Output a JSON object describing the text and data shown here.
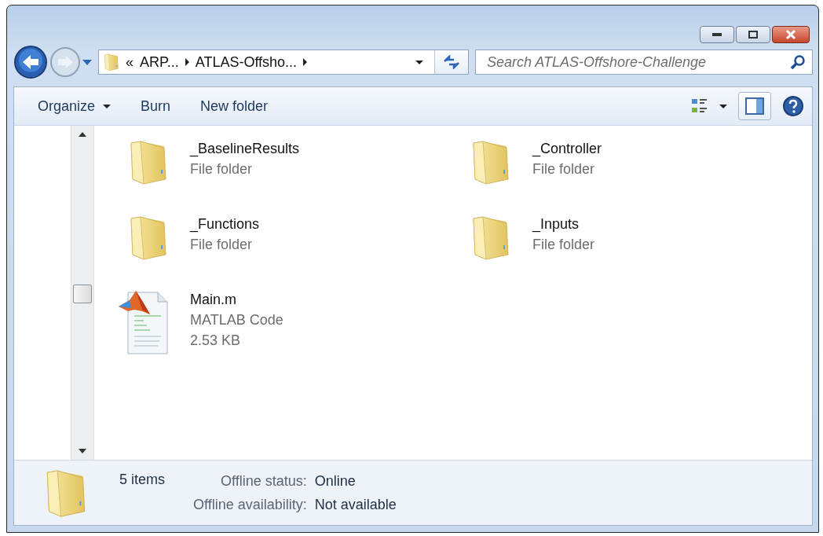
{
  "address": {
    "overflow": "«",
    "crumbs": [
      "ARP...",
      "ATLAS-Offsho..."
    ]
  },
  "search": {
    "placeholder": "Search ATLAS-Offshore-Challenge"
  },
  "toolbar": {
    "organize": "Organize",
    "buttons": [
      "Burn",
      "New folder"
    ]
  },
  "items": [
    {
      "kind": "folder",
      "name": "_BaselineResults",
      "type": "File folder"
    },
    {
      "kind": "folder",
      "name": "_Controller",
      "type": "File folder"
    },
    {
      "kind": "folder",
      "name": "_Functions",
      "type": "File folder"
    },
    {
      "kind": "folder",
      "name": "_Inputs",
      "type": "File folder"
    },
    {
      "kind": "matlab",
      "name": "Main.m",
      "type": "MATLAB Code",
      "size": "2.53 KB"
    }
  ],
  "status_bar": {
    "count": "5 items",
    "details": [
      {
        "label": "Offline status:",
        "value": "Online"
      },
      {
        "label": "Offline availability:",
        "value": "Not available"
      }
    ]
  }
}
